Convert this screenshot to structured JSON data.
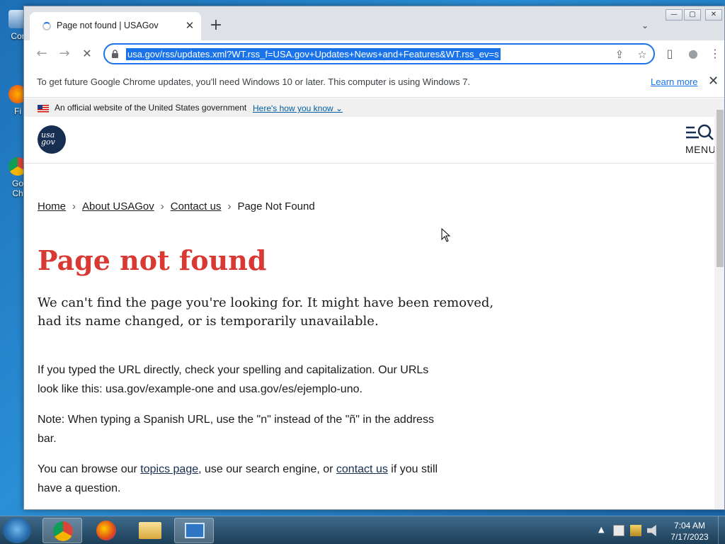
{
  "desktop": {
    "icons": [
      {
        "label": "Cor",
        "icon": "computer-icon"
      },
      {
        "label": "Fi",
        "icon": "firefox-icon"
      },
      {
        "label": "Go Ch",
        "icon": "chrome-icon"
      }
    ]
  },
  "browser": {
    "tab": {
      "title": "Page not found | USAGov",
      "close_label": "✕"
    },
    "new_tab_label": "+",
    "tab_search_glyph": "⌄",
    "window_controls": [
      "—",
      "▢",
      "✕"
    ],
    "toolbar": {
      "back_icon": "←",
      "forward_icon": "→",
      "stop_icon": "✕",
      "url": "usa.gov/rss/updates.xml?WT.rss_f=USA.gov+Updates+News+and+Features&WT.rss_ev=s",
      "share_icon": "⇪",
      "bookmark_icon": "☆",
      "sidepanel_icon": "▯",
      "profile_icon": "●",
      "menu_icon": "⋮"
    },
    "infobar": {
      "text": "To get future Google Chrome updates, you'll need Windows 10 or later. This computer is using Windows 7.",
      "link": "Learn more",
      "close": "✕"
    }
  },
  "page": {
    "gov_banner": {
      "text": "An official website of the United States government",
      "link": "Here's how you know ⌄"
    },
    "logo_text": "usa gov",
    "menu_label": "MENU",
    "breadcrumb": [
      "Home",
      "About USAGov",
      "Contact us",
      "Page Not Found"
    ],
    "breadcrumb_sep": "›",
    "title": "Page not found",
    "lead": "We can't find the page you're looking for. It might have been removed, had its name changed, or is temporarily unavailable.",
    "para1": "If you typed the URL directly, check your spelling and capitalization. Our URLs look like this: usa.gov/example-one and usa.gov/es/ejemplo-uno.",
    "para2": "Note: When typing a Spanish URL, use the \"n\" instead of the \"ñ\" in the address bar.",
    "para3": {
      "pre": "You can browse our ",
      "link1": "topics page",
      "mid": ", use our search engine, or ",
      "link2": "contact us",
      "post": " if you still have a question."
    }
  },
  "taskbar": {
    "apps": [
      "chrome-icon",
      "firefox-icon",
      "explorer-icon",
      "remote-desktop-icon"
    ],
    "tray_arrow": "▲",
    "clock": {
      "time": "7:04 AM",
      "date": "7/17/2023"
    }
  },
  "colors": {
    "accent": "#1a73e8",
    "title_red": "#d83933",
    "usagov_navy": "#162e51"
  }
}
